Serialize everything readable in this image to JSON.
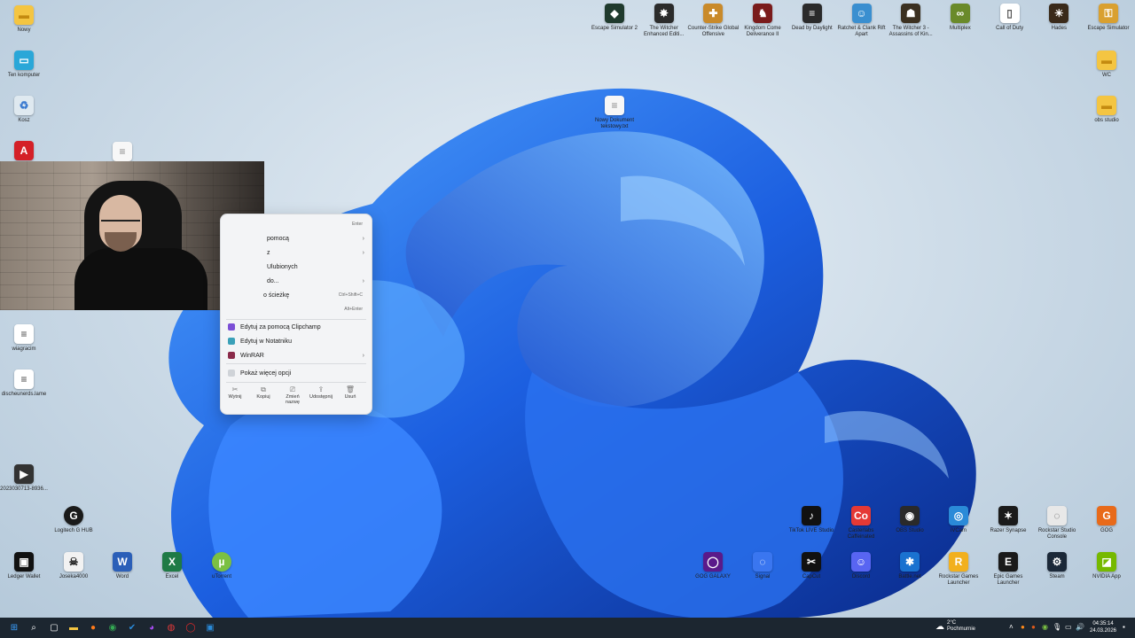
{
  "desktop_left": [
    {
      "label": "Nowy",
      "icon": "folder-icon",
      "color": "#f4c542",
      "glyph": "▬"
    },
    {
      "label": "Ten komputer",
      "icon": "monitor-icon",
      "color": "#2aa7d8",
      "glyph": "▭"
    },
    {
      "label": "Kosz",
      "icon": "recycle-bin-icon",
      "color": "#d9e6ee",
      "glyph": "♻"
    },
    {
      "label": "",
      "icon": "pdf-icon",
      "color": "#d42027",
      "glyph": "A"
    }
  ],
  "desktop_left_lower": [
    {
      "label": "wiagracim",
      "icon": "document-icon",
      "color": "#ffffff",
      "glyph": "≡"
    },
    {
      "label": "discheunerds.lame",
      "icon": "document-icon",
      "color": "#ffffff",
      "glyph": "≡"
    },
    {
      "label": "2023030713-8936...",
      "icon": "video-icon",
      "color": "#333333",
      "glyph": "▶"
    },
    {
      "label": "Logitech G HUB",
      "icon": "logitech-icon",
      "color": "#1a1a1a",
      "glyph": "G"
    }
  ],
  "desktop_bottom": [
    {
      "label": "Ledger Wallet",
      "icon": "ledger-icon",
      "color": "#111111",
      "glyph": "▣"
    },
    {
      "label": "Joseka4000",
      "icon": "alien-icon",
      "color": "#f2f2f2",
      "glyph": "☠"
    },
    {
      "label": "Word",
      "icon": "word-icon",
      "color": "#2b5fb8",
      "glyph": "W"
    },
    {
      "label": "Excel",
      "icon": "excel-icon",
      "color": "#1e7a45",
      "glyph": "X"
    },
    {
      "label": "uTorrent",
      "icon": "utorrent-icon",
      "color": "#7bc043",
      "glyph": "µ"
    }
  ],
  "desktop_top": [
    {
      "label": "Escape Simulator 2",
      "icon": "game-icon",
      "color": "#1f3a2d",
      "glyph": "◆"
    },
    {
      "label": "The Witcher Enhanced Editi...",
      "icon": "witcher-icon",
      "color": "#2b2b2b",
      "glyph": "✸"
    },
    {
      "label": "Counter-Strike Global Offensive",
      "icon": "cs-icon",
      "color": "#c98a2a",
      "glyph": "✚"
    },
    {
      "label": "Kingdom Come Deliverance II",
      "icon": "game-icon",
      "color": "#7a1b1b",
      "glyph": "♞"
    },
    {
      "label": "Dead by Daylight",
      "icon": "dbd-icon",
      "color": "#2a2a2a",
      "glyph": "≡"
    },
    {
      "label": "Ratchet & Clank Rift Apart",
      "icon": "game-icon",
      "color": "#3a8fd0",
      "glyph": "☺"
    },
    {
      "label": "The Witcher 3 - Assassins of Kin...",
      "icon": "witcher-icon",
      "color": "#3b3020",
      "glyph": "☗"
    },
    {
      "label": "Multiplex",
      "icon": "game-icon",
      "color": "#6a8a2a",
      "glyph": "∞"
    },
    {
      "label": "Call of Duty",
      "icon": "document-icon",
      "color": "#ffffff",
      "glyph": "▯"
    },
    {
      "label": "Hades",
      "icon": "hades-icon",
      "color": "#3a2a1a",
      "glyph": "☀"
    },
    {
      "label": "Escape Simulator",
      "icon": "escape-icon",
      "color": "#d9a030",
      "glyph": "⚿"
    }
  ],
  "desktop_right": [
    {
      "label": "WC",
      "icon": "folder-icon",
      "color": "#f4c542",
      "glyph": "▬"
    },
    {
      "label": "obs studio",
      "icon": "folder-icon",
      "color": "#f4c542",
      "glyph": "▬"
    }
  ],
  "desktop_center_file": {
    "label": "Nowy Dokument tekstowy.txt",
    "icon": "text-file-icon"
  },
  "desktop_mid_file": {
    "label": "",
    "icon": "text-file-icon"
  },
  "desktop_apps_row1": [
    {
      "label": "TikTok LIVE Studio",
      "icon": "tiktok-icon",
      "color": "#111111",
      "glyph": "♪"
    },
    {
      "label": "Casterlabs Caffeinated",
      "icon": "casterlabs-icon",
      "color": "#e53935",
      "glyph": "Co"
    },
    {
      "label": "OBS Studio",
      "icon": "obs-icon",
      "color": "#2a2a2a",
      "glyph": "◉"
    },
    {
      "label": "iVCam",
      "icon": "ivcam-icon",
      "color": "#2a8ad8",
      "glyph": "◎"
    },
    {
      "label": "Razer Synapse",
      "icon": "razer-icon",
      "color": "#1a1a1a",
      "glyph": "✶"
    },
    {
      "label": "Rockstar Studio Console",
      "icon": "rockstar-icon",
      "color": "#e8e8e8",
      "glyph": "◌"
    },
    {
      "label": "GOG",
      "icon": "gog-orange-icon",
      "color": "#e86a1a",
      "glyph": "G"
    }
  ],
  "desktop_apps_row2": [
    {
      "label": "GOG GALAXY",
      "icon": "gog-galaxy-icon",
      "color": "#5a1a8a",
      "glyph": "◯"
    },
    {
      "label": "Signal",
      "icon": "signal-icon",
      "color": "#3a76f0",
      "glyph": "◌"
    },
    {
      "label": "CapCut",
      "icon": "capcut-icon",
      "color": "#111111",
      "glyph": "✂"
    },
    {
      "label": "Discord",
      "icon": "discord-icon",
      "color": "#5865f2",
      "glyph": "☺"
    },
    {
      "label": "Battle.net",
      "icon": "battlenet-icon",
      "color": "#1a72d0",
      "glyph": "✱"
    },
    {
      "label": "Rockstar Games Launcher",
      "icon": "rockstar-icon",
      "color": "#f2b01e",
      "glyph": "R"
    },
    {
      "label": "Epic Games Launcher",
      "icon": "epic-icon",
      "color": "#1a1a1a",
      "glyph": "E"
    },
    {
      "label": "Steam",
      "icon": "steam-icon",
      "color": "#1b2838",
      "glyph": "⚙"
    },
    {
      "label": "NVIDIA App",
      "icon": "nvidia-icon",
      "color": "#76b900",
      "glyph": "◪"
    }
  ],
  "context_menu": {
    "items": [
      {
        "label": "",
        "short": "Enter",
        "arrow": false
      },
      {
        "label": "pomocą",
        "short": "",
        "arrow": true
      },
      {
        "label": "z",
        "short": "",
        "arrow": true
      },
      {
        "label": "Ulubionych",
        "short": "",
        "arrow": false
      },
      {
        "label": "do...",
        "short": "",
        "arrow": true
      },
      {
        "label": "o ścieżkę",
        "short": "Ctrl+Shift+C",
        "arrow": false
      },
      {
        "label": "",
        "short": "Alt+Enter",
        "arrow": false
      }
    ],
    "apps": [
      {
        "label": "Edytuj za pomocą Clipchamp",
        "icon": "clipchamp-icon",
        "color": "#7b4fd6"
      },
      {
        "label": "Edytuj w Notatniku",
        "icon": "notepad-icon",
        "color": "#3aa0b8"
      },
      {
        "label": "WinRAR",
        "icon": "winrar-icon",
        "color": "#8a2a4a"
      }
    ],
    "more": "Pokaż więcej opcji",
    "actions": [
      {
        "label": "Wytnij",
        "glyph": "✂",
        "icon": "cut-icon"
      },
      {
        "label": "Kopiuj",
        "glyph": "⧉",
        "icon": "copy-icon"
      },
      {
        "label": "Zmień nazwę",
        "glyph": "⎚",
        "icon": "rename-icon"
      },
      {
        "label": "Udostępnij",
        "glyph": "⇪",
        "icon": "share-icon"
      },
      {
        "label": "Usuń",
        "glyph": "🗑",
        "icon": "delete-icon"
      }
    ]
  },
  "taskbar": {
    "apps": [
      {
        "icon": "start-icon",
        "glyph": "⊞",
        "color": "#3aa0ff"
      },
      {
        "icon": "search-icon",
        "glyph": "⌕",
        "color": "#ffffff"
      },
      {
        "icon": "task-view-icon",
        "glyph": "▢",
        "color": "#ffffff"
      },
      {
        "icon": "file-explorer-icon",
        "glyph": "▬",
        "color": "#f4c542"
      },
      {
        "icon": "firefox-icon",
        "glyph": "●",
        "color": "#ff7a1a"
      },
      {
        "icon": "chrome-icon",
        "glyph": "◉",
        "color": "#34a853"
      },
      {
        "icon": "tasks-icon",
        "glyph": "✔",
        "color": "#2a8ad8"
      },
      {
        "icon": "messenger-icon",
        "glyph": "◕",
        "color": "#a64cf0"
      },
      {
        "icon": "app-icon",
        "glyph": "◍",
        "color": "#e83a3a"
      },
      {
        "icon": "opera-icon",
        "glyph": "◯",
        "color": "#e02a2a"
      },
      {
        "icon": "app-icon",
        "glyph": "▣",
        "color": "#2a8ad8"
      }
    ],
    "weather_temp": "2°C",
    "weather_desc": "Pochmurnie",
    "time": "04:35:14",
    "date": "24.03.2026"
  }
}
